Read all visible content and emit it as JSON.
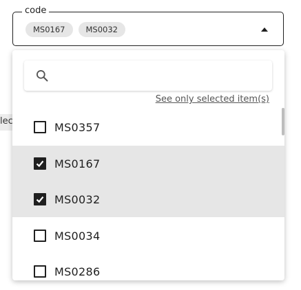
{
  "background": {
    "fragment_text": "lec"
  },
  "field": {
    "label": "code",
    "chips": [
      "MS0167",
      "MS0032"
    ]
  },
  "dropdown": {
    "see_only_selected": "See only selected item(s)",
    "options": [
      {
        "label": "MS0357",
        "checked": false
      },
      {
        "label": "MS0167",
        "checked": true
      },
      {
        "label": "MS0032",
        "checked": true
      },
      {
        "label": "MS0034",
        "checked": false
      },
      {
        "label": "MS0286",
        "checked": false
      }
    ]
  },
  "colors": {
    "selected_row": "#e6e6e6",
    "chip_bg": "#e6e6e6",
    "border": "#1f1f1f"
  },
  "icons": {
    "search": "search-icon",
    "arrow": "caret-up-icon",
    "check": "checkmark-icon"
  }
}
